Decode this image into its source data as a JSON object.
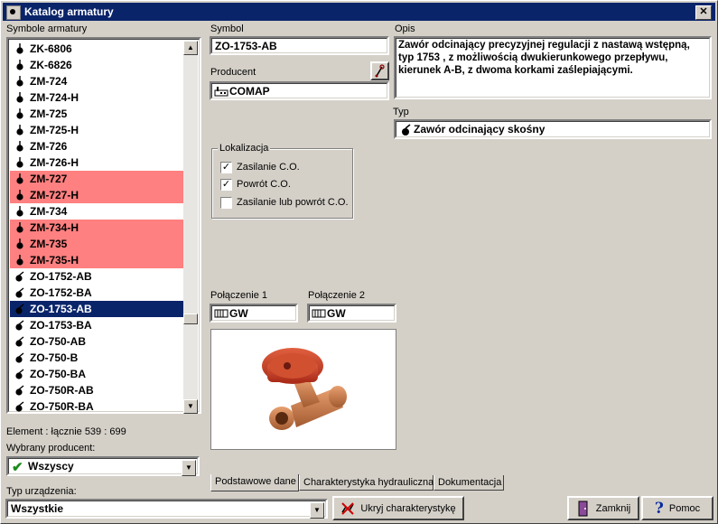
{
  "window": {
    "title": "Katalog armatury",
    "close": "✕"
  },
  "list": {
    "label": "Symbole armatury",
    "items": [
      {
        "text": "ZK-6806",
        "state": "normal"
      },
      {
        "text": "ZK-6826",
        "state": "normal"
      },
      {
        "text": "ZM-724",
        "state": "normal"
      },
      {
        "text": "ZM-724-H",
        "state": "normal"
      },
      {
        "text": "ZM-725",
        "state": "normal"
      },
      {
        "text": "ZM-725-H",
        "state": "normal"
      },
      {
        "text": "ZM-726",
        "state": "normal"
      },
      {
        "text": "ZM-726-H",
        "state": "normal"
      },
      {
        "text": "ZM-727",
        "state": "highlight"
      },
      {
        "text": "ZM-727-H",
        "state": "highlight"
      },
      {
        "text": "ZM-734",
        "state": "normal"
      },
      {
        "text": "ZM-734-H",
        "state": "highlight"
      },
      {
        "text": "ZM-735",
        "state": "highlight"
      },
      {
        "text": "ZM-735-H",
        "state": "highlight"
      },
      {
        "text": "ZO-1752-AB",
        "state": "normal"
      },
      {
        "text": "ZO-1752-BA",
        "state": "normal"
      },
      {
        "text": "ZO-1753-AB",
        "state": "selected"
      },
      {
        "text": "ZO-1753-BA",
        "state": "normal"
      },
      {
        "text": "ZO-750-AB",
        "state": "normal"
      },
      {
        "text": "ZO-750-B",
        "state": "normal"
      },
      {
        "text": "ZO-750-BA",
        "state": "normal"
      },
      {
        "text": "ZO-750R-AB",
        "state": "normal"
      },
      {
        "text": "ZO-750R-BA",
        "state": "normal"
      }
    ],
    "count_text": "Element : łącznie  539 : 699"
  },
  "producer_filter": {
    "label": "Wybrany producent:",
    "value": "Wszyscy"
  },
  "device_type": {
    "label": "Typ urządzenia:",
    "value": "Wszystkie"
  },
  "symbol": {
    "label": "Symbol",
    "value": "ZO-1753-AB"
  },
  "producer": {
    "label": "Producent",
    "value": "COMAP"
  },
  "description": {
    "label": "Opis",
    "value": "Zawór odcinający precyzyjnej regulacji z nastawą wstępną, typ 1753 , z możliwością dwukierunkowego przepływu, kierunek A-B, z dwoma korkami zaślepiającymi."
  },
  "type": {
    "label": "Typ",
    "value": "Zawór odcinający skośny"
  },
  "location": {
    "legend": "Lokalizacja",
    "options": [
      {
        "label": "Zasilanie C.O.",
        "checked": true
      },
      {
        "label": "Powrót C.O.",
        "checked": true
      },
      {
        "label": "Zasilanie lub powrót C.O.",
        "checked": false
      }
    ]
  },
  "connection1": {
    "label": "Połączenie 1",
    "value": "GW"
  },
  "connection2": {
    "label": "Połączenie 2",
    "value": "GW"
  },
  "tabs": [
    "Podstawowe dane",
    "Charakterystyka hydrauliczna",
    "Dokumentacja"
  ],
  "buttons": {
    "hide_char": "Ukryj charakterystykę",
    "close": "Zamknij",
    "help": "Pomoc"
  },
  "colors": {
    "highlight": "#ff8080",
    "selected": "#0a246a",
    "titlebar": "#0a246a"
  }
}
